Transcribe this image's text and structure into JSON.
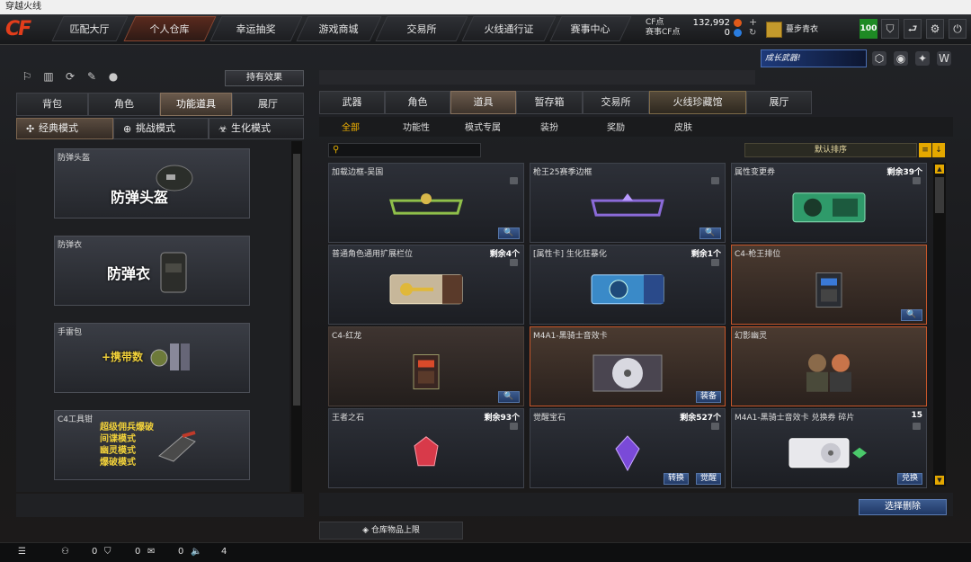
{
  "window_title": "穿越火线",
  "logo": "CF",
  "nav": {
    "tabs": [
      "匹配大厅",
      "个人仓库",
      "幸运抽奖",
      "游戏商城",
      "交易所",
      "火线通行证",
      "赛事中心"
    ],
    "active": "个人仓库"
  },
  "currency": {
    "cf_label": "CF点",
    "cf_value": "132,992",
    "event_label": "赛事CF点",
    "event_value": "0"
  },
  "user": {
    "name": "蔓步青衣",
    "level": "100"
  },
  "top_icons": [
    "shield-icon",
    "return-icon",
    "gear-icon",
    "power-icon"
  ],
  "promo": {
    "text": "成长武器!",
    "icons": [
      "badge-icon",
      "globe-icon",
      "shield-icon",
      "wing-icon"
    ]
  },
  "left": {
    "effects_button": "持有效果",
    "tabs": [
      "背包",
      "角色",
      "功能道具",
      "展厅"
    ],
    "active_tab": "功能道具",
    "modes": [
      "经典模式",
      "挑战模式",
      "生化模式"
    ],
    "active_mode": "经典模式",
    "items": [
      {
        "caption": "防弹头盔",
        "title": "防弹头盔"
      },
      {
        "caption": "防弹衣",
        "title": "防弹衣"
      },
      {
        "caption": "手雷包",
        "title": "+携带数"
      },
      {
        "caption": "C4工具钳",
        "lines": [
          "超级佣兵爆破",
          "间谍模式",
          "幽灵模式",
          "爆破模式"
        ]
      }
    ]
  },
  "right": {
    "tabs": [
      "武器",
      "角色",
      "道具",
      "暂存箱",
      "交易所",
      "火线珍藏馆",
      "展厅"
    ],
    "active_tab": "道具",
    "special_tab": "火线珍藏馆",
    "subtabs": [
      "全部",
      "功能性",
      "模式专属",
      "装扮",
      "奖励",
      "皮肤"
    ],
    "active_subtab": "全部",
    "search_placeholder": "",
    "sort_label": "默认排序",
    "items": [
      {
        "name": "加载边框-吴国",
        "count": "",
        "style": "normal",
        "buttons": [
          "search"
        ]
      },
      {
        "name": "枪王25赛季边框",
        "count": "",
        "style": "normal",
        "buttons": [
          "search"
        ]
      },
      {
        "name": "属性变更券",
        "count": "剩余39个",
        "style": "normal",
        "buttons": []
      },
      {
        "name": "普通角色通用扩展栏位",
        "count": "剩余4个",
        "style": "normal",
        "buttons": []
      },
      {
        "name": "[属性卡] 生化狂暴化",
        "count": "剩余1个",
        "style": "normal",
        "buttons": []
      },
      {
        "name": "C4-枪王排位",
        "count": "",
        "style": "rare",
        "buttons": [
          "search"
        ]
      },
      {
        "name": "C4-红龙",
        "count": "",
        "style": "brown",
        "buttons": [
          "search"
        ]
      },
      {
        "name": "M4A1-黑骑士音效卡",
        "count": "",
        "style": "rare",
        "buttons": [
          "装备"
        ]
      },
      {
        "name": "幻影幽灵",
        "count": "",
        "style": "rare",
        "buttons": []
      },
      {
        "name": "王者之石",
        "count": "剩余93个",
        "style": "normal",
        "buttons": []
      },
      {
        "name": "觉醒宝石",
        "count": "剩余527个",
        "style": "normal",
        "buttons": [
          "转换",
          "觉醒"
        ]
      },
      {
        "name": "M4A1-黑骑士音效卡 兑换券 碎片",
        "count": "15",
        "style": "normal",
        "buttons": [
          "兑换"
        ]
      }
    ],
    "delete_button": "选择删除",
    "limit_label": "仓库物品上限"
  },
  "status": {
    "values": [
      "0",
      "0",
      "0",
      "4"
    ]
  }
}
